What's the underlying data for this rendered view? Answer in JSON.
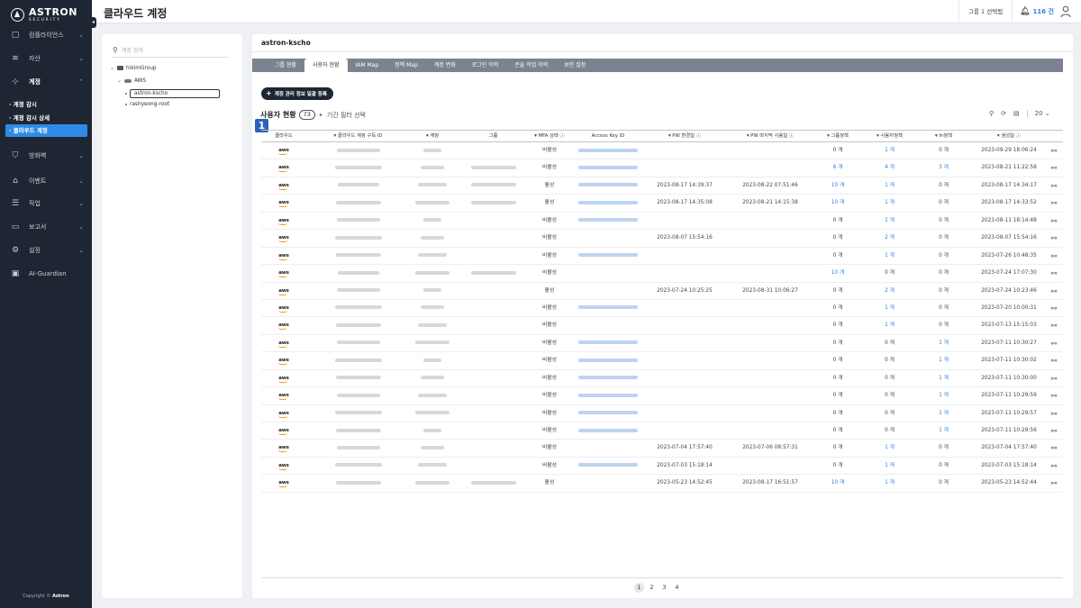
{
  "brand": {
    "name": "ASTRON",
    "sub": "SECURITY"
  },
  "sidebar": {
    "items": [
      {
        "label": "컴플라이언스",
        "icon": "document-icon",
        "chev": "⌄"
      },
      {
        "label": "자산",
        "icon": "database-icon",
        "chev": "⌄"
      },
      {
        "label": "계정",
        "icon": "org-chart-icon",
        "chev": "⌃"
      },
      {
        "label": "방화벽",
        "icon": "shield-icon",
        "chev": "⌄"
      },
      {
        "label": "이벤트",
        "icon": "house-icon",
        "chev": "⌄"
      },
      {
        "label": "작업",
        "icon": "list-icon",
        "chev": "⌄"
      },
      {
        "label": "보고서",
        "icon": "report-icon",
        "chev": "⌄"
      },
      {
        "label": "설정",
        "icon": "gear-icon",
        "chev": "⌄"
      },
      {
        "label": "AI-Guardian",
        "icon": "robot-icon",
        "chev": ""
      }
    ],
    "subitems": [
      "· 계정 감시",
      "· 계정 감시 상세",
      "· 클라우드 계정"
    ],
    "copyright_prefix": "Copyright ©",
    "copyright_brand": "Astron"
  },
  "header": {
    "title": "클라우드 계정",
    "group_select": "그룹 1 선택됨",
    "notif_count": "116 건"
  },
  "tree": {
    "search_placeholder": "계정 검색",
    "group": "hikimGroup",
    "provider": "AWS",
    "accounts": [
      "astron-kscho",
      "rashyeong-root"
    ]
  },
  "main": {
    "account_name": "astron-kscho",
    "tabs": [
      "그룹 현황",
      "사용자 현황",
      "IAM Map",
      "정책 Map",
      "계정 변화",
      "로그인 이력",
      "콘솔 작업 이력",
      "보안 설정"
    ],
    "bulk_button": "계정 관리 정보 일괄 등록",
    "section_title": "사용자 현황",
    "count": "73",
    "period_filter": "기간 필터 선택",
    "step": "1",
    "page_size": "20",
    "columns": [
      "클라우드",
      "▾ 클라우드 계정 구독 ID",
      "▾ 계정",
      "그룹",
      "▾ MFA 상태 ⓘ",
      "Access Key ID",
      "▾ PW 변경일 ⓘ",
      "▾ PW 마지막 사용일 ⓘ",
      "▾ 그룹정책",
      "▾ 사용자정책",
      "▾ In정책",
      "▾ 생성일 ⓘ"
    ],
    "rows": [
      {
        "cloud": "aws",
        "mfa": "비활성",
        "pw_changed": "",
        "pw_last": "",
        "grp": "0 개",
        "usr": "1 개",
        "inl": "0 개",
        "created": "2023-09-29 18:06:24",
        "ak": true,
        "grp_l": false,
        "usr_l": true,
        "inl_l": false,
        "g": false
      },
      {
        "cloud": "aws",
        "mfa": "비활성",
        "pw_changed": "",
        "pw_last": "",
        "grp": "6 개",
        "usr": "4 개",
        "inl": "3 개",
        "created": "2023-08-21 11:22:58",
        "ak": true,
        "grp_l": true,
        "usr_l": true,
        "inl_l": true,
        "g": true
      },
      {
        "cloud": "aws",
        "mfa": "활성",
        "pw_changed": "2023-08-17 14:39:37",
        "pw_last": "2023-08-22 07:51:46",
        "grp": "10 개",
        "usr": "1 개",
        "inl": "0 개",
        "created": "2023-08-17 14:34:17",
        "ak": true,
        "grp_l": true,
        "usr_l": true,
        "inl_l": false,
        "g": true
      },
      {
        "cloud": "aws",
        "mfa": "활성",
        "pw_changed": "2023-08-17 14:35:08",
        "pw_last": "2023-08-21 14:15:38",
        "grp": "10 개",
        "usr": "1 개",
        "inl": "0 개",
        "created": "2023-08-17 14:33:52",
        "ak": true,
        "grp_l": true,
        "usr_l": true,
        "inl_l": false,
        "g": true
      },
      {
        "cloud": "aws",
        "mfa": "비활성",
        "pw_changed": "",
        "pw_last": "",
        "grp": "0 개",
        "usr": "1 개",
        "inl": "0 개",
        "created": "2023-08-11 18:14:48",
        "ak": true,
        "grp_l": false,
        "usr_l": true,
        "inl_l": false,
        "g": false
      },
      {
        "cloud": "aws",
        "mfa": "비활성",
        "pw_changed": "2023-08-07 15:54:16",
        "pw_last": "",
        "grp": "0 개",
        "usr": "2 개",
        "inl": "0 개",
        "created": "2023-08-07 15:54:16",
        "ak": false,
        "grp_l": false,
        "usr_l": true,
        "inl_l": false,
        "g": false
      },
      {
        "cloud": "aws",
        "mfa": "비활성",
        "pw_changed": "",
        "pw_last": "",
        "grp": "0 개",
        "usr": "1 개",
        "inl": "0 개",
        "created": "2023-07-26 10:48:35",
        "ak": true,
        "grp_l": false,
        "usr_l": true,
        "inl_l": false,
        "g": false
      },
      {
        "cloud": "aws",
        "mfa": "비활성",
        "pw_changed": "",
        "pw_last": "",
        "grp": "10 개",
        "usr": "0 개",
        "inl": "0 개",
        "created": "2023-07-24 17:07:30",
        "ak": false,
        "grp_l": true,
        "usr_l": false,
        "inl_l": false,
        "g": true
      },
      {
        "cloud": "aws",
        "mfa": "활성",
        "pw_changed": "2023-07-24 10:25:25",
        "pw_last": "2023-08-31 10:06:27",
        "grp": "0 개",
        "usr": "2 개",
        "inl": "0 개",
        "created": "2023-07-24 10:23:46",
        "ak": false,
        "grp_l": false,
        "usr_l": true,
        "inl_l": false,
        "g": false
      },
      {
        "cloud": "aws",
        "mfa": "비활성",
        "pw_changed": "",
        "pw_last": "",
        "grp": "0 개",
        "usr": "1 개",
        "inl": "0 개",
        "created": "2023-07-20 10:00:31",
        "ak": true,
        "grp_l": false,
        "usr_l": true,
        "inl_l": false,
        "g": false
      },
      {
        "cloud": "aws",
        "mfa": "비활성",
        "pw_changed": "",
        "pw_last": "",
        "grp": "0 개",
        "usr": "1 개",
        "inl": "0 개",
        "created": "2023-07-13 15:15:03",
        "ak": false,
        "grp_l": false,
        "usr_l": true,
        "inl_l": false,
        "g": false
      },
      {
        "cloud": "aws",
        "mfa": "비활성",
        "pw_changed": "",
        "pw_last": "",
        "grp": "0 개",
        "usr": "0 개",
        "inl": "1 개",
        "created": "2023-07-11 10:30:27",
        "ak": true,
        "grp_l": false,
        "usr_l": false,
        "inl_l": true,
        "g": false
      },
      {
        "cloud": "aws",
        "mfa": "비활성",
        "pw_changed": "",
        "pw_last": "",
        "grp": "0 개",
        "usr": "0 개",
        "inl": "1 개",
        "created": "2023-07-11 10:30:02",
        "ak": true,
        "grp_l": false,
        "usr_l": false,
        "inl_l": true,
        "g": false
      },
      {
        "cloud": "aws",
        "mfa": "비활성",
        "pw_changed": "",
        "pw_last": "",
        "grp": "0 개",
        "usr": "0 개",
        "inl": "1 개",
        "created": "2023-07-11 10:30:00",
        "ak": true,
        "grp_l": false,
        "usr_l": false,
        "inl_l": true,
        "g": false
      },
      {
        "cloud": "aws",
        "mfa": "비활성",
        "pw_changed": "",
        "pw_last": "",
        "grp": "0 개",
        "usr": "0 개",
        "inl": "1 개",
        "created": "2023-07-11 10:29:59",
        "ak": true,
        "grp_l": false,
        "usr_l": false,
        "inl_l": true,
        "g": false
      },
      {
        "cloud": "aws",
        "mfa": "비활성",
        "pw_changed": "",
        "pw_last": "",
        "grp": "0 개",
        "usr": "0 개",
        "inl": "1 개",
        "created": "2023-07-11 10:29:57",
        "ak": true,
        "grp_l": false,
        "usr_l": false,
        "inl_l": true,
        "g": false
      },
      {
        "cloud": "aws",
        "mfa": "비활성",
        "pw_changed": "",
        "pw_last": "",
        "grp": "0 개",
        "usr": "0 개",
        "inl": "1 개",
        "created": "2023-07-11 10:29:56",
        "ak": true,
        "grp_l": false,
        "usr_l": false,
        "inl_l": true,
        "g": false
      },
      {
        "cloud": "aws",
        "mfa": "비활성",
        "pw_changed": "2023-07-04 17:57:40",
        "pw_last": "2023-07-06 08:57:31",
        "grp": "0 개",
        "usr": "1 개",
        "inl": "0 개",
        "created": "2023-07-04 17:57:40",
        "ak": false,
        "grp_l": false,
        "usr_l": true,
        "inl_l": false,
        "g": false
      },
      {
        "cloud": "aws",
        "mfa": "비활성",
        "pw_changed": "2023-07-03 15:18:14",
        "pw_last": "",
        "grp": "0 개",
        "usr": "1 개",
        "inl": "0 개",
        "created": "2023-07-03 15:18:14",
        "ak": true,
        "grp_l": false,
        "usr_l": true,
        "inl_l": false,
        "g": false
      },
      {
        "cloud": "aws",
        "mfa": "활성",
        "pw_changed": "2023-05-23 14:52:45",
        "pw_last": "2023-08-17 16:51:57",
        "grp": "10 개",
        "usr": "1 개",
        "inl": "0 개",
        "created": "2023-05-23 14:52:44",
        "ak": false,
        "grp_l": true,
        "usr_l": true,
        "inl_l": false,
        "g": true
      }
    ],
    "pages": [
      "1",
      "2",
      "3",
      "4"
    ],
    "current_page": "1"
  },
  "colors": {
    "sidebar_bg": "#1f2633",
    "accent": "#2d8be6",
    "link": "#2d7fe0",
    "tab_bar": "#7c8390"
  }
}
